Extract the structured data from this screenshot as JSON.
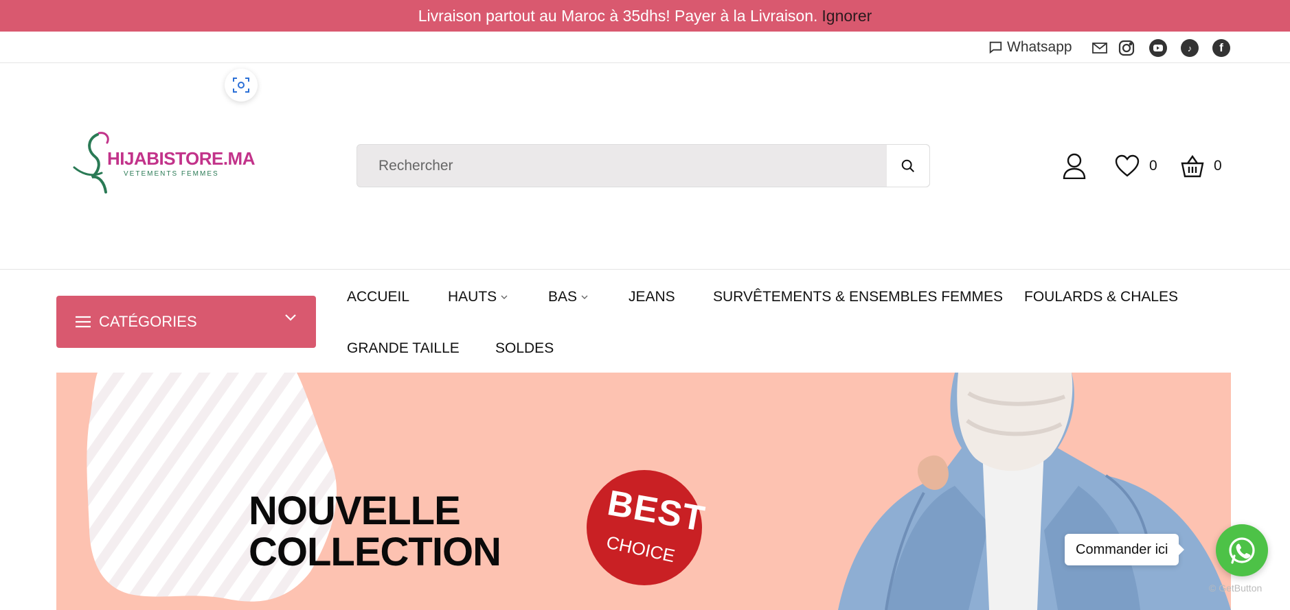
{
  "announcement": {
    "text": "Livraison partout au Maroc à 35dhs! Payer à la Livraison.",
    "dismiss": "Ignorer",
    "bg_color": "#d9596f"
  },
  "topbar": {
    "whatsapp_label": "Whatsapp",
    "social_icons": [
      "mail-icon",
      "instagram-icon",
      "youtube-icon",
      "tiktok-icon",
      "facebook-icon"
    ]
  },
  "logo": {
    "brand": "HIJABISTORE.MA",
    "tagline": "VETEMENTS FEMMES"
  },
  "search": {
    "placeholder": "Rechercher"
  },
  "header_icons": {
    "wishlist_count": "0",
    "cart_count": "0"
  },
  "nav": {
    "categories_label": "CATÉGORIES",
    "items": [
      {
        "label": "ACCUEIL"
      },
      {
        "label": "HAUTS"
      },
      {
        "label": "BAS"
      },
      {
        "label": "JEANS"
      },
      {
        "label": "SURVÊTEMENTS & ENSEMBLES FEMMES"
      },
      {
        "label": "FOULARDS & CHALES"
      },
      {
        "label": "GRANDE TAILLE"
      },
      {
        "label": "SOLDES"
      }
    ]
  },
  "hero": {
    "title_line1": "NOUVELLE",
    "title_line2": "COLLECTION",
    "badge_line1": "BEST",
    "badge_line2": "CHOICE",
    "bg_color": "#fdc2b1"
  },
  "whatsapp_widget": {
    "tooltip": "Commander ici",
    "powered_by": "GetButton"
  }
}
